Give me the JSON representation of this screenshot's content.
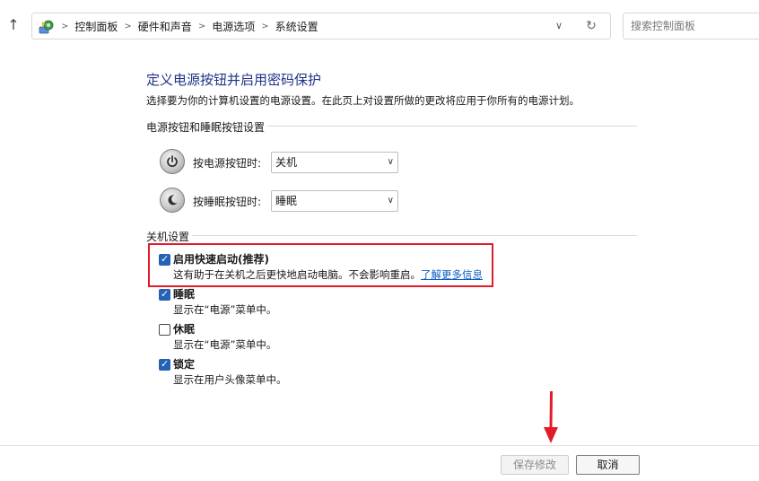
{
  "nav": {
    "breadcrumbs": [
      "控制面板",
      "硬件和声音",
      "电源选项",
      "系统设置"
    ],
    "search_placeholder": "搜索控制面板"
  },
  "page": {
    "title": "定义电源按钮并启用密码保护",
    "description": "选择要为你的计算机设置的电源设置。在此页上对设置所做的更改将应用于你所有的电源计划。"
  },
  "button_settings": {
    "header": "电源按钮和睡眠按钮设置",
    "power_button_label": "按电源按钮时:",
    "power_button_value": "关机",
    "sleep_button_label": "按睡眠按钮时:",
    "sleep_button_value": "睡眠"
  },
  "shutdown_settings": {
    "header": "关机设置",
    "items": [
      {
        "label": "启用快速启动(推荐)",
        "desc": "这有助于在关机之后更快地启动电脑。不会影响重启。",
        "link": "了解更多信息",
        "checked": true
      },
      {
        "label": "睡眠",
        "desc": "显示在“电源”菜单中。",
        "checked": true
      },
      {
        "label": "休眠",
        "desc": "显示在“电源”菜单中。",
        "checked": false
      },
      {
        "label": "锁定",
        "desc": "显示在用户头像菜单中。",
        "checked": true
      }
    ]
  },
  "footer": {
    "save_label": "保存修改",
    "cancel_label": "取消"
  },
  "colors": {
    "title": "#1e3287",
    "checkbox": "#2463b4",
    "highlight": "#e21b2b",
    "link": "#0b5ac4"
  },
  "icons": [
    "up-arrow-icon",
    "control-panel-icon",
    "chevron-right-icon",
    "chevron-down-icon",
    "refresh-icon",
    "power-button-icon",
    "sleep-button-icon",
    "checkbox-check-icon",
    "red-arrow-annotation"
  ]
}
